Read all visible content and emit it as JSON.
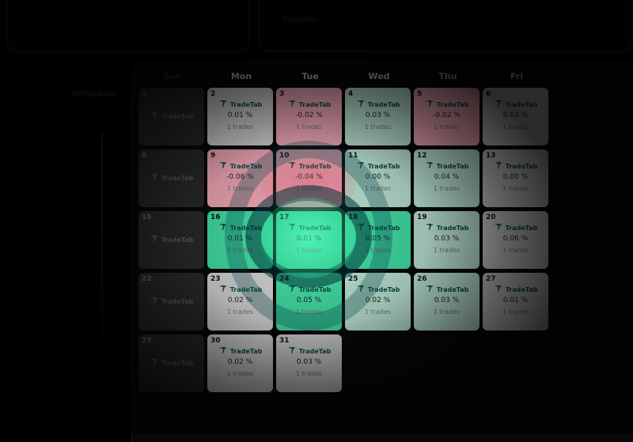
{
  "top_card_text": "TradeTab",
  "sidebar_label": "Withdrawal",
  "weekdays": [
    "Sun",
    "Mon",
    "Tue",
    "Wed",
    "Thu",
    "Fri"
  ],
  "brand": "TradeTab",
  "trades_label": "1 trades",
  "colors": {
    "profit": "#43e0a6",
    "loss": "#f4a9b8",
    "neutral": "#d6d6d6",
    "weekend": "#2b2b2b"
  },
  "days": [
    {
      "day": "1",
      "kind": "weekend",
      "pct": "",
      "trades": ""
    },
    {
      "day": "2",
      "kind": "neutral",
      "pct": "0.01 %",
      "trades": "1 trades"
    },
    {
      "day": "3",
      "kind": "loss",
      "pct": "-0.02 %",
      "trades": "1 trades"
    },
    {
      "day": "4",
      "kind": "profit-light",
      "pct": "0.03 %",
      "trades": "1 trades"
    },
    {
      "day": "5",
      "kind": "loss",
      "pct": "-0.02 %",
      "trades": "1 trades"
    },
    {
      "day": "6",
      "kind": "neutral",
      "pct": "0.03 %",
      "trades": "1 trades"
    },
    {
      "day": "8",
      "kind": "weekend",
      "pct": "",
      "trades": ""
    },
    {
      "day": "9",
      "kind": "loss",
      "pct": "-0.06 %",
      "trades": "1 trades"
    },
    {
      "day": "10",
      "kind": "loss",
      "pct": "-0.04 %",
      "trades": "1 trades"
    },
    {
      "day": "11",
      "kind": "profit-light",
      "pct": "0.00 %",
      "trades": "1 trades"
    },
    {
      "day": "12",
      "kind": "profit-light",
      "pct": "0.04 %",
      "trades": "1 trades"
    },
    {
      "day": "13",
      "kind": "neutral",
      "pct": "0.00 %",
      "trades": "1 trades"
    },
    {
      "day": "15",
      "kind": "weekend",
      "pct": "",
      "trades": ""
    },
    {
      "day": "16",
      "kind": "profit",
      "pct": "0.01 %",
      "trades": "1 trades"
    },
    {
      "day": "17",
      "kind": "profit",
      "pct": "0.01 %",
      "trades": "1 trades"
    },
    {
      "day": "18",
      "kind": "profit",
      "pct": "0.05 %",
      "trades": "1 trades"
    },
    {
      "day": "19",
      "kind": "profit-light",
      "pct": "0.03 %",
      "trades": "1 trades"
    },
    {
      "day": "20",
      "kind": "neutral",
      "pct": "0.06 %",
      "trades": "1 trades"
    },
    {
      "day": "22",
      "kind": "weekend",
      "pct": "",
      "trades": ""
    },
    {
      "day": "23",
      "kind": "neutral",
      "pct": "0.02 %",
      "trades": "1 trades"
    },
    {
      "day": "24",
      "kind": "profit",
      "pct": "0.05 %",
      "trades": "1 trades"
    },
    {
      "day": "25",
      "kind": "profit-light",
      "pct": "0.02 %",
      "trades": "1 trades"
    },
    {
      "day": "26",
      "kind": "profit-light",
      "pct": "0.03 %",
      "trades": "1 trades"
    },
    {
      "day": "27",
      "kind": "neutral",
      "pct": "0.01 %",
      "trades": "1 trades"
    },
    {
      "day": "29",
      "kind": "weekend",
      "pct": "",
      "trades": ""
    },
    {
      "day": "30",
      "kind": "neutral",
      "pct": "0.02 %",
      "trades": "1 trades"
    },
    {
      "day": "31",
      "kind": "neutral",
      "pct": "0.03 %",
      "trades": "1 trades"
    }
  ]
}
